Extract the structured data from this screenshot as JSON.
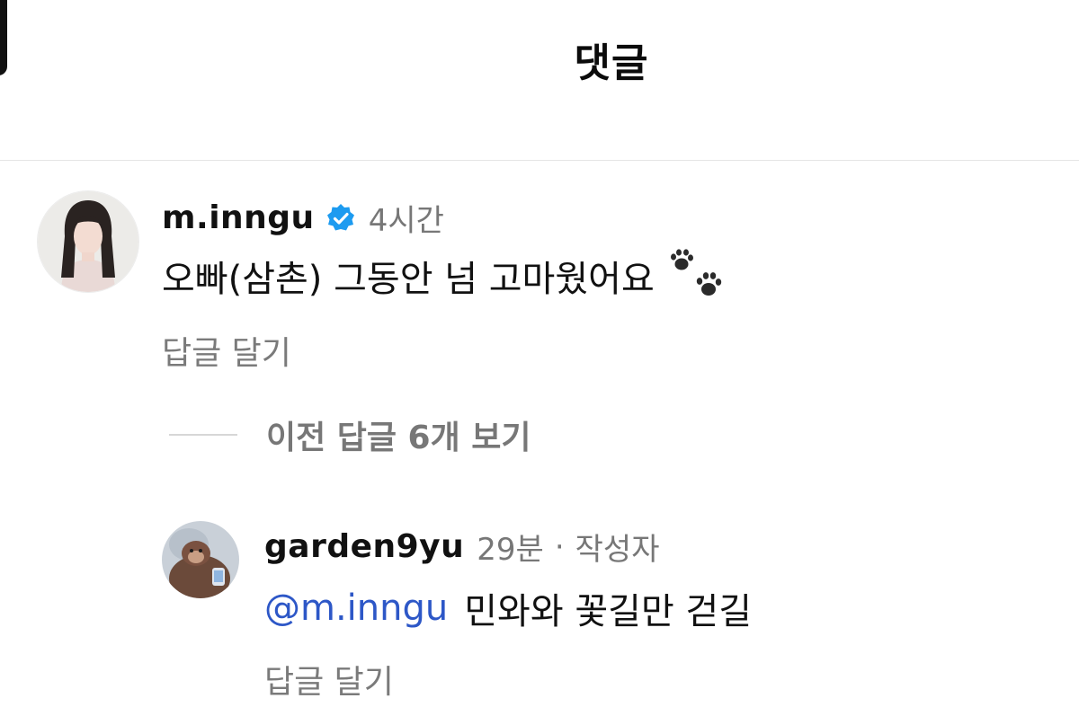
{
  "header": {
    "title": "댓글"
  },
  "comments": [
    {
      "username": "m.inngu",
      "verified": true,
      "time": "4시간",
      "text": "오빠(삼촌) 그동안 넘 고마웠어요",
      "emoji": "paw-prints",
      "reply_label": "답글 달기"
    }
  ],
  "view_previous_replies": "이전 답글 6개 보기",
  "replies": [
    {
      "username": "garden9yu",
      "time": "29분",
      "separator": "·",
      "author_badge": "작성자",
      "mention": "@m.inngu",
      "text": "민와와 꽃길만 걷길",
      "reply_label": "답글 달기"
    }
  ],
  "colors": {
    "mention": "#2d57c7",
    "verified_badge": "#1d9bf0",
    "muted_text": "#777777"
  }
}
